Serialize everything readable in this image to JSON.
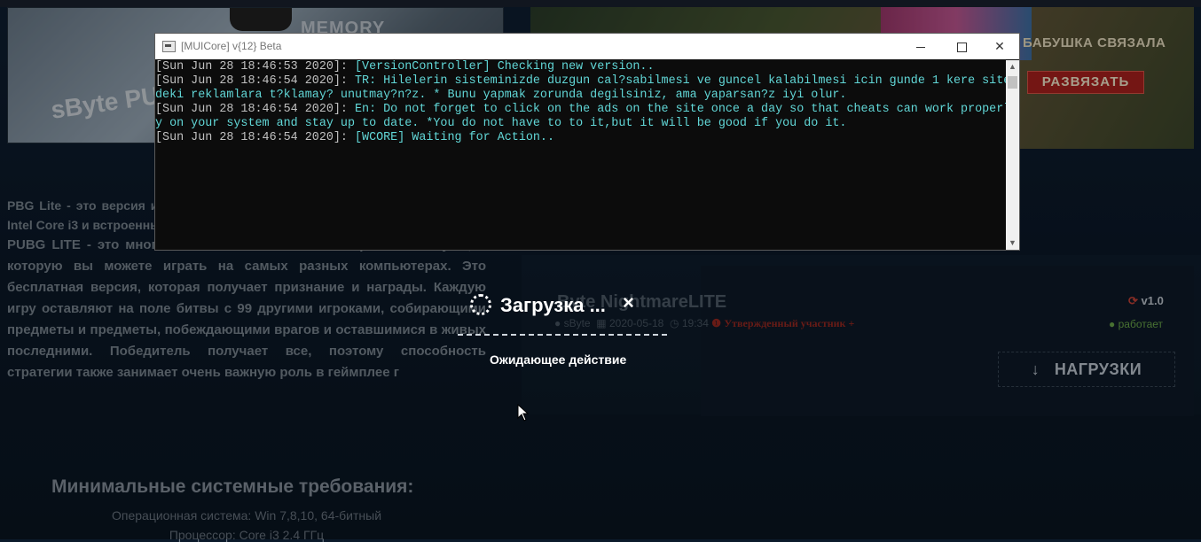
{
  "window": {
    "title": "[MUICore] v{12} Beta",
    "controls": {
      "minimize": "minimize",
      "maximize": "maximize",
      "close": "close"
    }
  },
  "console": {
    "lines": [
      {
        "ts": "[Sun Jun 28 18:46:53 2020]:",
        "msg": " [VersionController] Checking new version.."
      },
      {
        "ts": "[Sun Jun 28 18:46:54 2020]:",
        "msg": " TR: Hilelerin sisteminizde duzgun cal?sabilmesi ve guncel kalabilmesi icin gunde 1 kere site"
      },
      {
        "ts": "",
        "msg": "deki reklamlara t?klamay? unutmay?n?z. * Bunu yapmak zorunda degilsiniz, ama yaparsan?z iyi olur."
      },
      {
        "ts": "[Sun Jun 28 18:46:54 2020]:",
        "msg": " En: Do not forget to click on the ads on the site once a day so that cheats can work properl"
      },
      {
        "ts": "",
        "msg": "y on your system and stay up to date. *You do not have to to it,but it will be good if you do it."
      },
      {
        "ts": "[Sun Jun 28 18:46:54 2020]:",
        "msg": " [WCORE] Waiting for Action.."
      }
    ]
  },
  "background": {
    "thumb_left": {
      "text_memory": "MEMORY",
      "text_brand": "sByte PUB"
    },
    "thumb_right": {
      "heading": "БАБУШКА СВЯЗАЛА",
      "button": "РАЗВЯЗАТЬ"
    },
    "description": {
      "p1": "PBG Lite - это версия игры с низкоуровне играть в эту версию процессор Intel Core i3 и встроенный графический процессор.",
      "p2": "PUBG LITE - это многопользовательская онлайн-игра Battle Royale, в которую вы можете играть на самых разных компьютерах. Это бесплатная версия, которая получает признание и награды. Каждую игру оставляют на поле битвы с 99 другими игроками, собирающими предметы и предметы, побеждающими врагов и оставшимися в живых последними. Победитель получает все, поэтому способность стратегии также занимает очень важную роль в геймплее г"
    },
    "requirements": {
      "title": "Минимальные системные требования:",
      "os": "Операционная система: Win 7,8,10, 64-битный",
      "cpu": "Процессор: Core i3 2.4 ГГц"
    },
    "product": {
      "title": "Byte NightmareLITE",
      "author": "sByte",
      "date": "2020-05-18",
      "time": "19:34",
      "badge": "Утвержденный участник +",
      "version": "v1.0",
      "status": "работает",
      "download_label": "НАГРУЗКИ"
    }
  },
  "loading": {
    "title": "Загрузка ...",
    "close": "×",
    "subtitle": "Ожидающее действие"
  }
}
